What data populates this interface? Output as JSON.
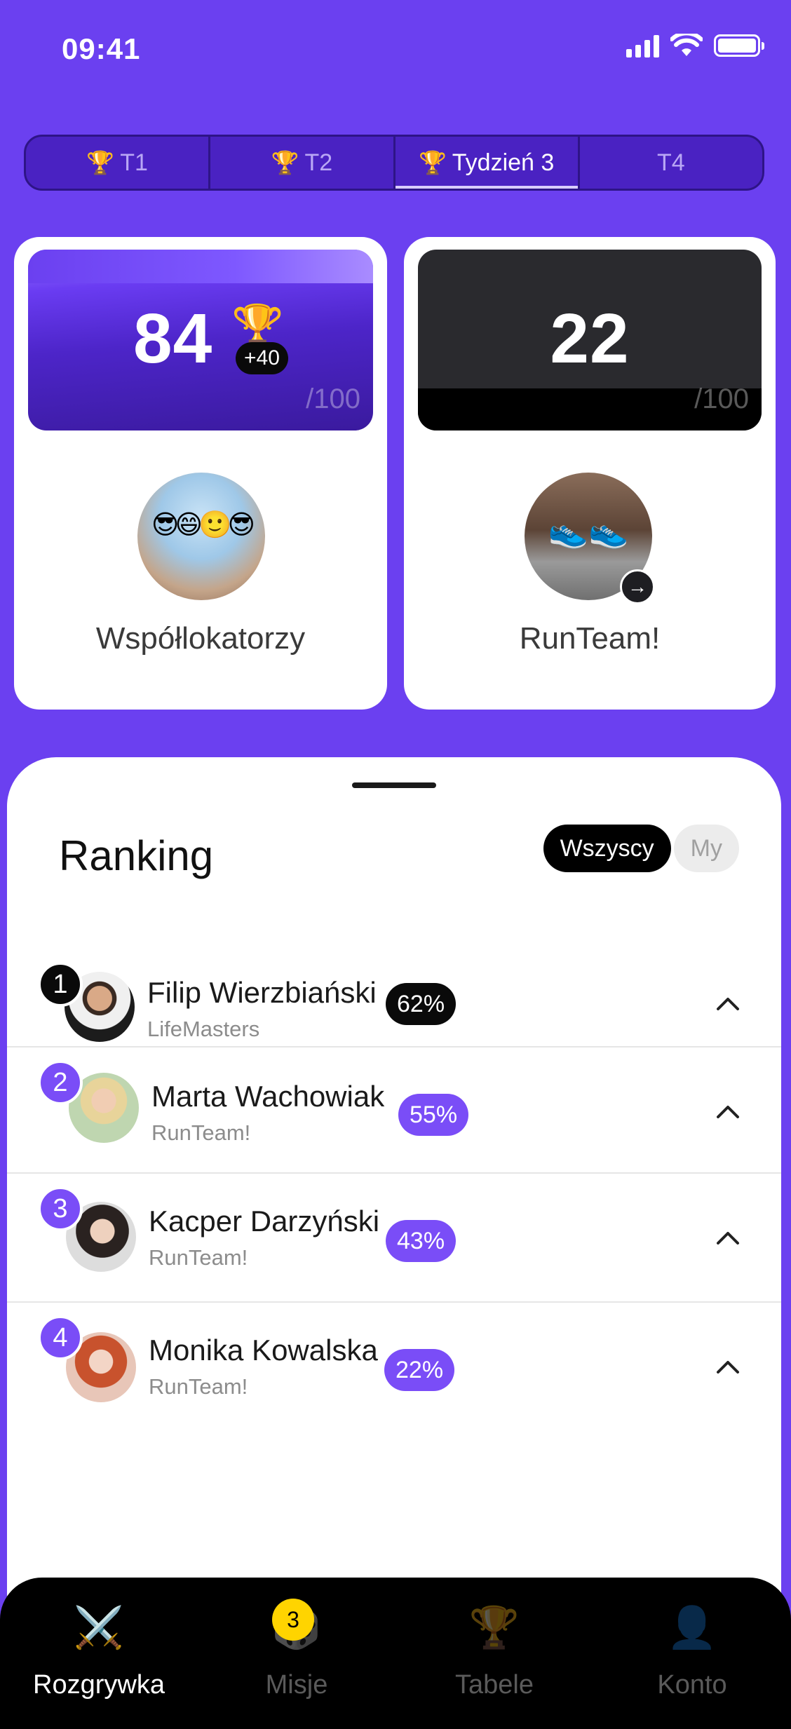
{
  "status_bar": {
    "time": "09:41"
  },
  "week_tabs": [
    {
      "label": "T1",
      "icon": "trophy-icon",
      "active": false
    },
    {
      "label": "T2",
      "icon": "trophy-icon",
      "active": false
    },
    {
      "label": "Tydzień 3",
      "icon": "trophy-icon",
      "active": true
    },
    {
      "label": "T4",
      "icon": "",
      "active": false
    }
  ],
  "scores": {
    "left": {
      "value": "84",
      "bonus": "+40",
      "max": "/100",
      "team_name": "Współlokatorzy"
    },
    "right": {
      "value": "22",
      "max": "/100",
      "team_name": "RunTeam!"
    }
  },
  "ranking": {
    "title": "Ranking",
    "filters": {
      "all": "Wszyscy",
      "mine": "My"
    },
    "rows": [
      {
        "rank": "1",
        "name": "Filip Wierzbiański",
        "team": "LifeMasters",
        "percent": "62%"
      },
      {
        "rank": "2",
        "name": "Marta Wachowiak",
        "team": "RunTeam!",
        "percent": "55%"
      },
      {
        "rank": "3",
        "name": "Kacper Darzyński",
        "team": "RunTeam!",
        "percent": "43%"
      },
      {
        "rank": "4",
        "name": "Monika Kowalska",
        "team": "RunTeam!",
        "percent": "22%"
      }
    ]
  },
  "bottom_nav": {
    "items": [
      {
        "label": "Rozgrywka",
        "icon": "swords-icon",
        "active": true
      },
      {
        "label": "Misje",
        "icon": "dice-icon",
        "badge": "3",
        "active": false
      },
      {
        "label": "Tabele",
        "icon": "trophy-icon",
        "active": false
      },
      {
        "label": "Konto",
        "icon": "person-icon",
        "active": false
      }
    ]
  },
  "colors": {
    "brand": "#6B40F0",
    "accent_purple": "#7A4DF7",
    "badge_yellow": "#FFD400"
  }
}
